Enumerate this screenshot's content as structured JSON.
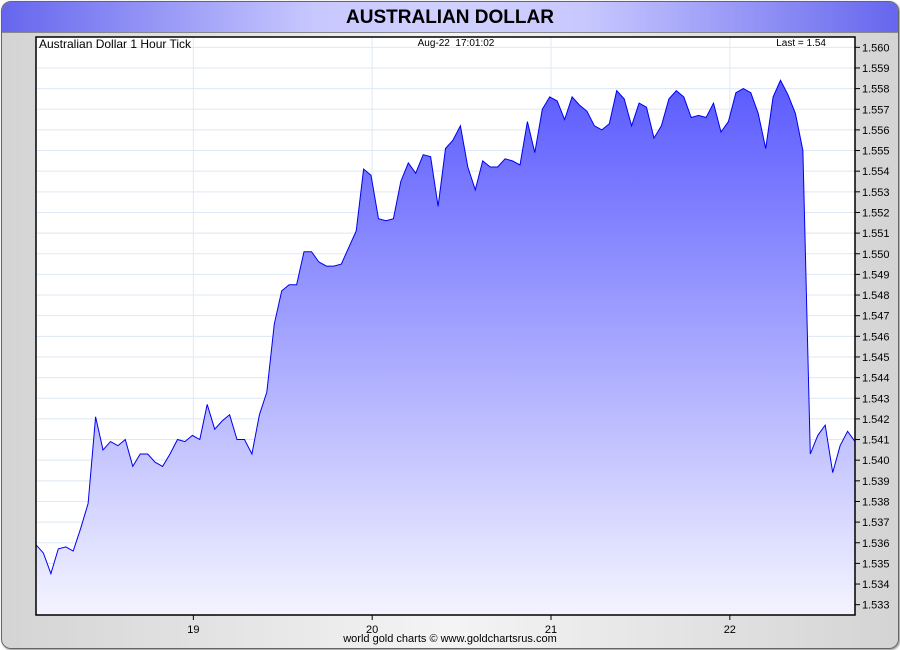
{
  "header": {
    "title": "AUSTRALIAN DOLLAR"
  },
  "chart_data": {
    "type": "area",
    "title": "Australian Dollar 1 Hour Tick",
    "timestamp": "Aug-22  17:01:02",
    "last_label": "Last = 1.54",
    "xlabel": "",
    "ylabel": "",
    "xlim": [
      18.12,
      22.7
    ],
    "ylim": [
      1.5325,
      1.5605
    ],
    "x_ticks": [
      19,
      20,
      21,
      22
    ],
    "x_tick_labels": [
      "19",
      "20",
      "21",
      "22"
    ],
    "y_ticks": [
      1.533,
      1.534,
      1.535,
      1.536,
      1.537,
      1.538,
      1.539,
      1.54,
      1.541,
      1.542,
      1.543,
      1.544,
      1.545,
      1.546,
      1.547,
      1.548,
      1.549,
      1.55,
      1.551,
      1.552,
      1.553,
      1.554,
      1.555,
      1.556,
      1.557,
      1.558,
      1.559,
      1.56
    ],
    "y_tick_labels": [
      "1.533",
      "1.534",
      "1.535",
      "1.536",
      "1.537",
      "1.538",
      "1.539",
      "1.540",
      "1.541",
      "1.542",
      "1.543",
      "1.544",
      "1.545",
      "1.546",
      "1.547",
      "1.548",
      "1.549",
      "1.550",
      "1.551",
      "1.552",
      "1.553",
      "1.554",
      "1.555",
      "1.556",
      "1.557",
      "1.558",
      "1.559",
      "1.560"
    ],
    "grid": true,
    "series": [
      {
        "name": "Australian Dollar",
        "x_start": 18.12,
        "x_end": 22.7,
        "values": [
          1.5359,
          1.5355,
          1.5345,
          1.5357,
          1.5358,
          1.5356,
          1.5367,
          1.5379,
          1.5421,
          1.5405,
          1.5409,
          1.5407,
          1.541,
          1.5397,
          1.5403,
          1.5403,
          1.5399,
          1.5397,
          1.5403,
          1.541,
          1.5409,
          1.5412,
          1.541,
          1.5427,
          1.5415,
          1.5419,
          1.5422,
          1.541,
          1.541,
          1.5403,
          1.5422,
          1.5433,
          1.5466,
          1.5482,
          1.5485,
          1.5485,
          1.5501,
          1.5501,
          1.5496,
          1.5494,
          1.5494,
          1.5495,
          1.5503,
          1.5511,
          1.5541,
          1.5538,
          1.5517,
          1.5516,
          1.5517,
          1.5535,
          1.5544,
          1.5539,
          1.5548,
          1.5547,
          1.5523,
          1.5551,
          1.5555,
          1.5562,
          1.5542,
          1.5531,
          1.5545,
          1.5542,
          1.5542,
          1.5546,
          1.5545,
          1.5543,
          1.5564,
          1.5549,
          1.557,
          1.5576,
          1.5574,
          1.5565,
          1.5576,
          1.5572,
          1.5569,
          1.5562,
          1.556,
          1.5563,
          1.5579,
          1.5575,
          1.5562,
          1.5573,
          1.5571,
          1.5556,
          1.5562,
          1.5575,
          1.5579,
          1.5576,
          1.5566,
          1.5567,
          1.5566,
          1.5573,
          1.5559,
          1.5564,
          1.5578,
          1.558,
          1.5578,
          1.5568,
          1.5551,
          1.5576,
          1.5584,
          1.5577,
          1.5568,
          1.555,
          1.5403,
          1.5412,
          1.5417,
          1.5394,
          1.5407,
          1.5414,
          1.5409
        ]
      }
    ]
  },
  "footer": {
    "credit": "world gold charts © www.goldchartsrus.com"
  },
  "colors": {
    "line": "#0000ee",
    "fill_top": "#5a5aff",
    "fill_bottom": "#f4f4ff",
    "grid": "#dde8f4"
  }
}
